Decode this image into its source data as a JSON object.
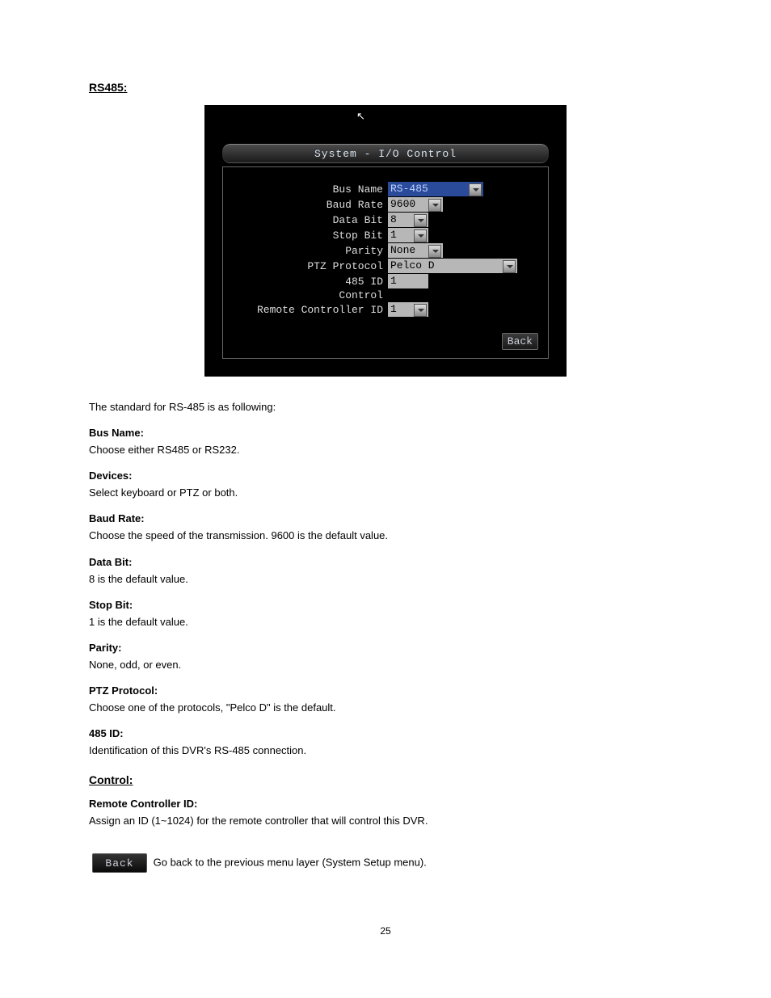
{
  "headings": {
    "rs485": "RS485:",
    "control": "Control:"
  },
  "screenshot": {
    "title": "System - I/O Control",
    "rows": {
      "bus_name_label": "Bus Name",
      "bus_name_value": "RS-485",
      "baud_rate_label": "Baud Rate",
      "baud_rate_value": "9600",
      "data_bit_label": "Data Bit",
      "data_bit_value": "8",
      "stop_bit_label": "Stop Bit",
      "stop_bit_value": "1",
      "parity_label": "Parity",
      "parity_value": "None",
      "ptz_protocol_label": "PTZ Protocol",
      "ptz_protocol_value": "Pelco D",
      "id485_label": "485 ID",
      "id485_value": "1",
      "control_label": "Control",
      "remote_id_label": "Remote Controller ID",
      "remote_id_value": "1"
    },
    "back": "Back"
  },
  "text": {
    "rs485_intro": "The standard for RS-485 is as following:",
    "bus_name": "Choose either RS485 or RS232.",
    "devices": "Select keyboard or PTZ or both.",
    "baud_rate": "Choose the speed of the transmission. 9600 is the default value.",
    "data_bit": "8 is the default value.",
    "stop_bit": "1 is the default value.",
    "parity": "None, odd, or even.",
    "ptz_protocol": "Choose one of the protocols, \"Pelco D\" is the default.",
    "id485": "Identification of this DVR's RS-485 connection.",
    "control_rcid": "Remote Controller ID:",
    "control_desc": "Assign an ID (1~1024) for the remote controller that will control this DVR.",
    "back_desc": "Go back to the previous menu layer (System Setup menu)."
  },
  "labels": {
    "bus_name": "Bus Name:",
    "devices": "Devices:",
    "baud_rate": "Baud Rate:",
    "data_bit": "Data Bit:",
    "stop_bit": "Stop Bit:",
    "parity": "Parity:",
    "ptz_protocol": "PTZ Protocol:",
    "id485": "485 ID:"
  },
  "inline_back": "Back",
  "page_number": "25"
}
